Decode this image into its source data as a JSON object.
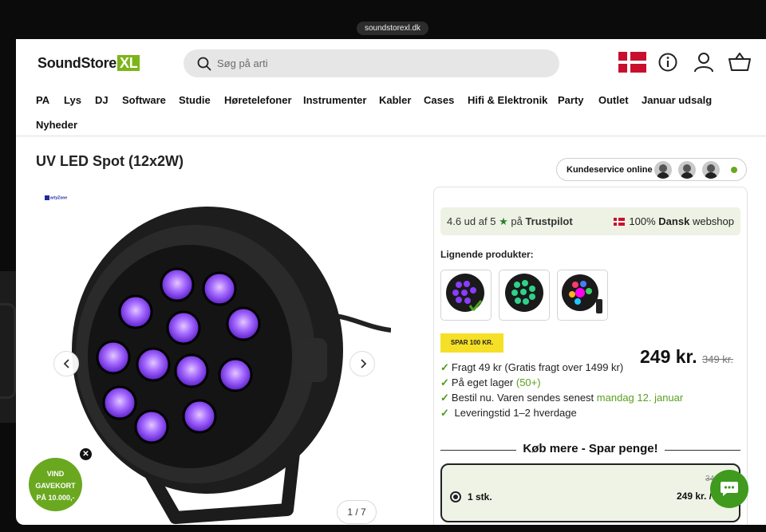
{
  "browser": {
    "url": "soundstorexl.dk"
  },
  "header": {
    "logo_text": "SoundStore",
    "logo_badge": "XL",
    "search_placeholder": "Søg på arti"
  },
  "nav": {
    "items": [
      "PA",
      "Lys",
      "DJ",
      "Software",
      "Studie",
      "Høretelefoner",
      "Instrumenter",
      "Kabler",
      "Cases",
      "Hifi & Elektronik",
      "Party",
      "Outlet",
      "Januar udsalg",
      "Nyheder"
    ]
  },
  "product": {
    "title": "UV LED Spot (12x2W)",
    "brand_tag": "artyZone",
    "image_counter": "1 / 7"
  },
  "support": {
    "label": "Kundeservice online"
  },
  "trustpilot": {
    "rating_text": "4.6 ud af 5",
    "star": "★",
    "on": "på",
    "brand": "Trustpilot",
    "dansk_prefix": "100%",
    "dansk_bold": "Dansk",
    "dansk_suffix": "webshop"
  },
  "similar": {
    "label": "Lignende produkter:"
  },
  "pricing": {
    "badge": "SPAR 100 KR.",
    "price": "249 kr.",
    "old_price": "349 kr."
  },
  "features": [
    {
      "check": "✓",
      "text": "Fragt 49 kr (Gratis fragt over 1499 kr)"
    },
    {
      "check": "✓",
      "text": "På eget lager",
      "extra": "(50+)"
    },
    {
      "check": "✓",
      "text": "Bestil nu. Varen sendes senest",
      "extra": "mandag 12. januar"
    },
    {
      "check": "✓",
      "text": " Leveringstid 1–2 hverdage"
    }
  ],
  "buy_more": {
    "title": "Køb mere - Spar penge!",
    "option": {
      "qty": "1 stk.",
      "price": "249 kr. /",
      "old_price": "34"
    }
  },
  "promo": {
    "line1": "VIND",
    "line2": "GAVEKORT",
    "line3": "PÅ 10.000,-",
    "close": "✕"
  },
  "colors": {
    "brand_green": "#7cb518",
    "chat_green": "#3f9a1d",
    "uv_purple": "#8a3cff"
  }
}
